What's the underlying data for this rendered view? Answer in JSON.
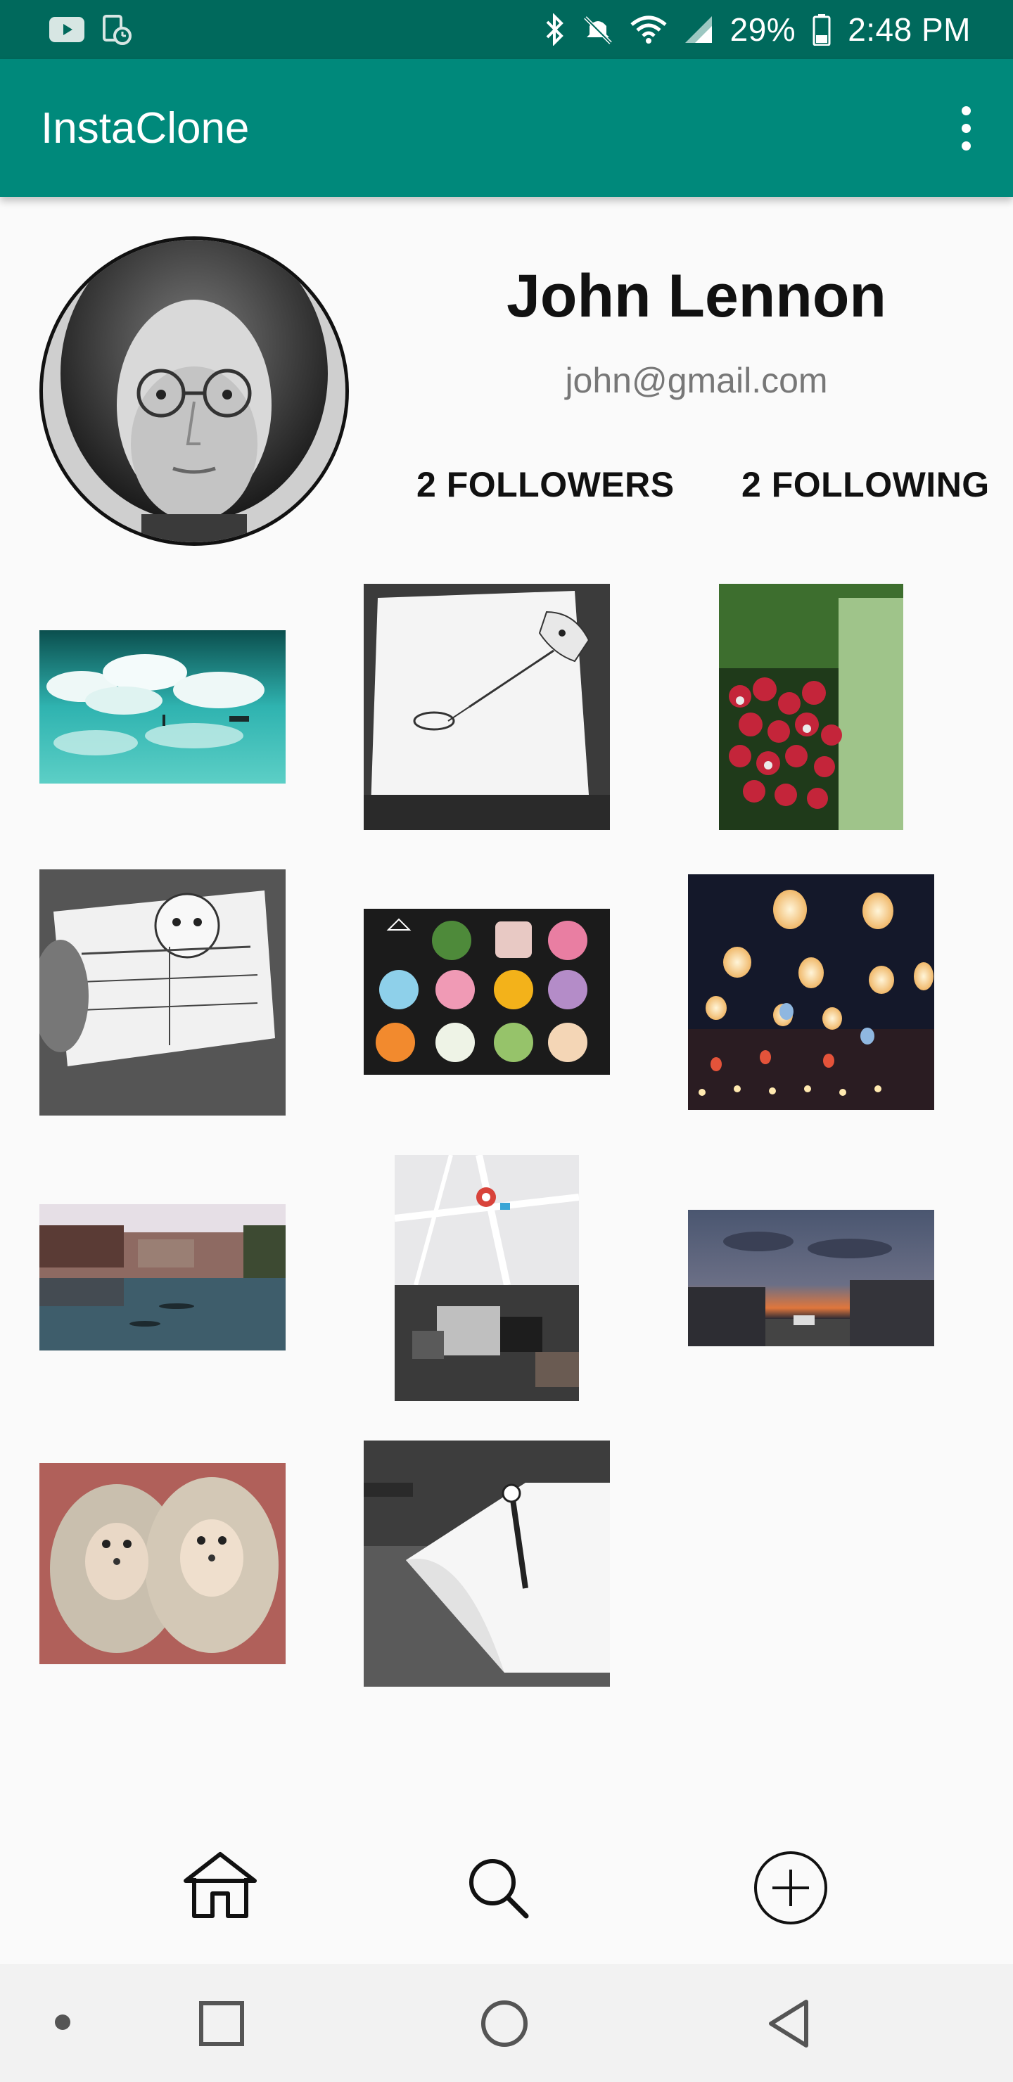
{
  "status_bar": {
    "battery": "29%",
    "time": "2:48 PM",
    "icons": [
      "youtube-icon",
      "screen-time-icon",
      "bluetooth-icon",
      "mute-icon",
      "wifi-icon",
      "cellular-signal-icon",
      "battery-icon"
    ]
  },
  "app_bar": {
    "title": "InstaClone",
    "menu_icon": "overflow-menu-icon"
  },
  "profile": {
    "name": "John Lennon",
    "email": "john@gmail.com",
    "followers_label": "2 FOLLOWERS",
    "following_label": "2 FOLLOWING"
  },
  "posts": [
    {
      "subject": "clouds reflected on water"
    },
    {
      "subject": "paper drawing fishing"
    },
    {
      "subject": "radishes"
    },
    {
      "subject": "sketch newspaper reader"
    },
    {
      "subject": "japanese wagashi sweets"
    },
    {
      "subject": "paper lanterns at night"
    },
    {
      "subject": "river town"
    },
    {
      "subject": "map and car crash"
    },
    {
      "subject": "sunset street"
    },
    {
      "subject": "hedgehogs"
    },
    {
      "subject": "paper sketch figure"
    }
  ],
  "bottom_nav": {
    "items": [
      "home-icon",
      "search-icon",
      "add-post-icon"
    ]
  },
  "system_nav": {
    "items": [
      "dot-icon",
      "recents-icon",
      "home-circle-icon",
      "back-icon"
    ]
  },
  "colors": {
    "status_bar": "#00695c",
    "app_bar": "#00897b",
    "background": "#fafafa"
  }
}
